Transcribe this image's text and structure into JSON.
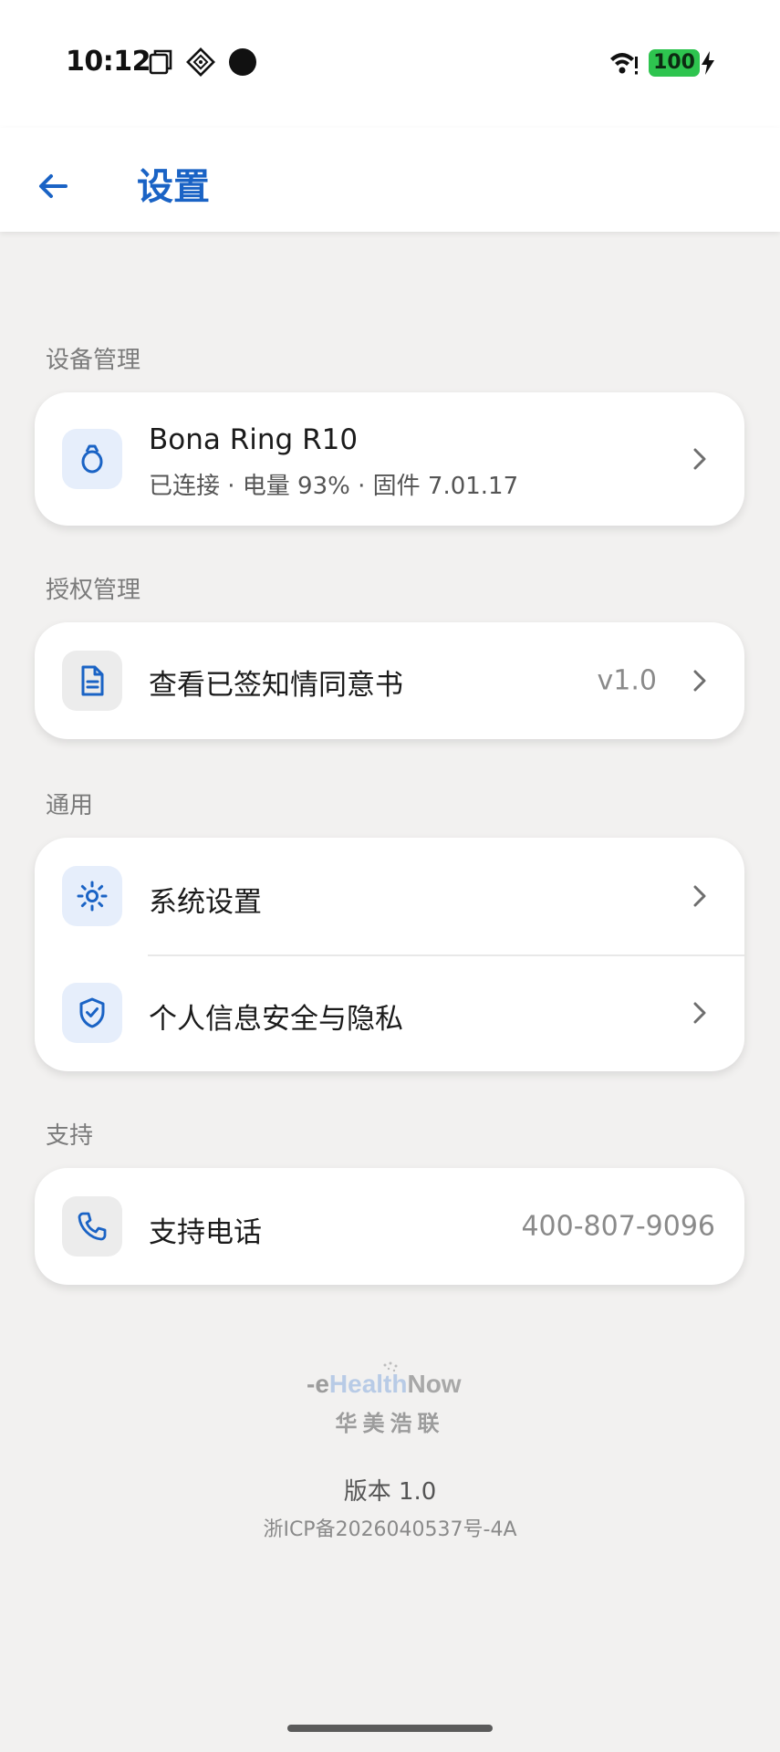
{
  "status_bar": {
    "time": "10:12",
    "battery_level": "100",
    "battery_color": "#2ec44f"
  },
  "app_bar": {
    "title": "设置",
    "accent": "#1a63c5"
  },
  "sections": {
    "device": {
      "label": "设备管理",
      "items": [
        {
          "title": "Bona Ring R10",
          "subtitle": "已连接 · 电量 93% · 固件 7.01.17",
          "icon": "ring-icon"
        }
      ]
    },
    "authorization": {
      "label": "授权管理",
      "items": [
        {
          "title": "查看已签知情同意书",
          "value": "v1.0",
          "icon": "document-icon"
        }
      ]
    },
    "general": {
      "label": "通用",
      "items": [
        {
          "title": "系统设置",
          "icon": "gear-icon"
        },
        {
          "title": "个人信息安全与隐私",
          "icon": "shield-check-icon"
        }
      ]
    },
    "support": {
      "label": "支持",
      "items": [
        {
          "title": "支持电话",
          "value": "400-807-9096",
          "icon": "phone-icon"
        }
      ]
    }
  },
  "footer": {
    "brand_en_prefix": "-e",
    "brand_en_health": "Health",
    "brand_en_now": "Now",
    "brand_cn": "华美浩联",
    "version": "版本 1.0",
    "icp": "浙ICP备2026040537号-4A"
  }
}
